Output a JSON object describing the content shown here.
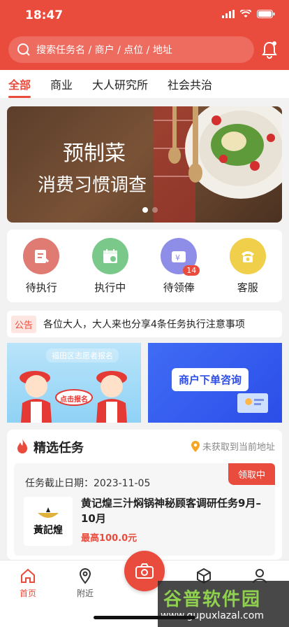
{
  "status_bar": {
    "time": "18:47"
  },
  "search": {
    "placeholder": "搜索任务名 / 商户 / 点位 / 地址"
  },
  "categories": [
    {
      "label": "全部",
      "active": true
    },
    {
      "label": "商业",
      "active": false
    },
    {
      "label": "大人研究所",
      "active": false
    },
    {
      "label": "社会共治",
      "active": false
    }
  ],
  "banner": {
    "line1": "预制菜",
    "line2": "消费习惯调查",
    "slide": 1,
    "slides": 2
  },
  "quick_actions": [
    {
      "label": "待执行",
      "icon": "pending-task-icon",
      "color": "#e07b73"
    },
    {
      "label": "执行中",
      "icon": "calendar-icon",
      "color": "#7bc98a"
    },
    {
      "label": "待领俸",
      "icon": "wallet-icon",
      "color": "#8e8ee8",
      "badge": "14"
    },
    {
      "label": "客服",
      "icon": "phone-icon",
      "color": "#f0cf4a"
    }
  ],
  "notice": {
    "tag": "公告",
    "text": "各位大人，大人来也分享4条任务执行注意事项"
  },
  "promos": [
    {
      "title": "福田区志愿者报名",
      "sub": "点击报名"
    },
    {
      "title": "商户下单咨询"
    }
  ],
  "section": {
    "title": "精选任务",
    "location": "未获取到当前地址"
  },
  "task": {
    "deadline": "任务截止日期：2023-11-05",
    "status": "领取中",
    "title": "黄记煌三汁焖锅神秘顾客调研任务9月–10月",
    "price": "最高100.0元",
    "logo_text": "黃記煌"
  },
  "tabbar": [
    {
      "label": "首页",
      "active": true,
      "icon": "home-icon"
    },
    {
      "label": "附近",
      "active": false,
      "icon": "location-icon"
    },
    {
      "label": "",
      "active": false,
      "icon": "camera-icon"
    },
    {
      "label": "",
      "active": false,
      "icon": "box-icon"
    },
    {
      "label": "",
      "active": false,
      "icon": "person-icon"
    }
  ],
  "watermark": {
    "text": "谷普软件园",
    "url": "www.gupuxlazal.com"
  },
  "colors": {
    "accent": "#e94b3c"
  }
}
